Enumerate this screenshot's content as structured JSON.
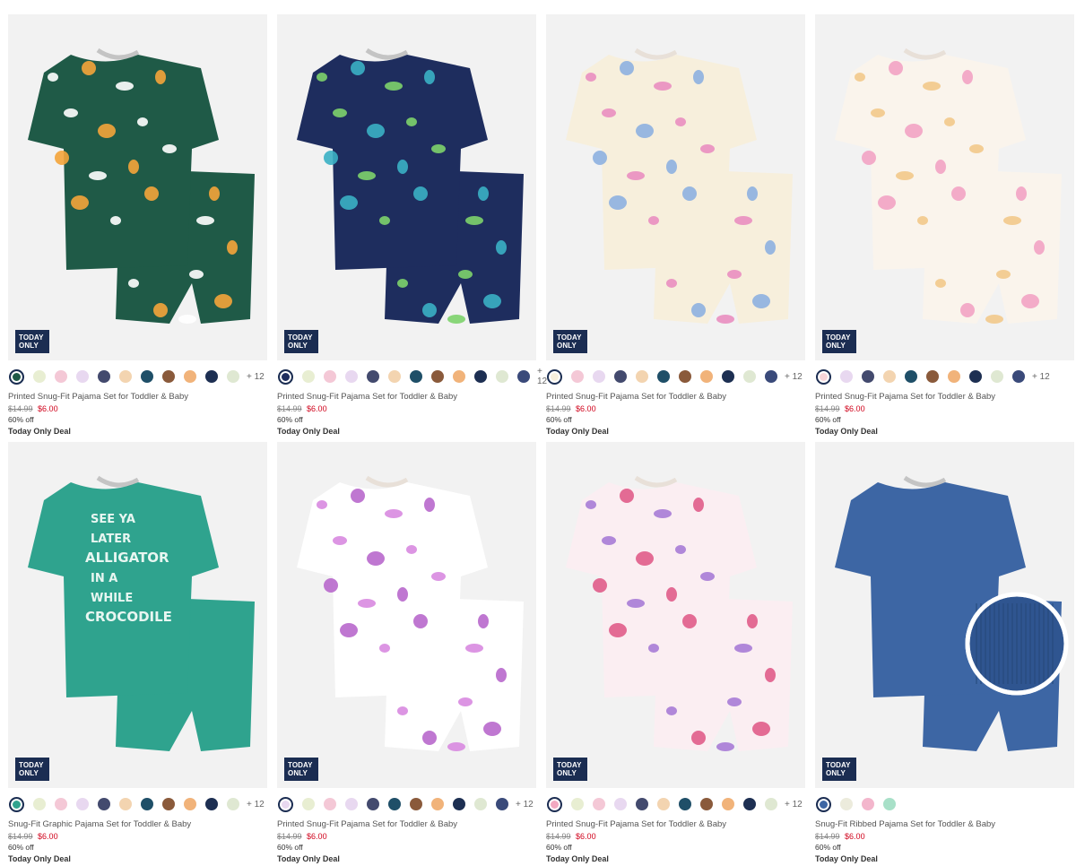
{
  "products": [
    {
      "title": "Printed Snug-Fit Pajama Set for Toddler & Baby",
      "badge": [
        "TODAY",
        "ONLY"
      ],
      "price_was": "$14.99",
      "price_now": "$6.00",
      "discount": "60% off",
      "deal": "Today Only Deal",
      "more_colors": "+ 12",
      "art": {
        "bg": "#1f5a47",
        "accent": "#f4a43a",
        "accent2": "#ffffff"
      },
      "swatches": [
        "#1f5a47",
        "#e8eed2",
        "#f4c8d6",
        "#e8d8f0",
        "#434a6e",
        "#f3d4b0",
        "#1f4f68",
        "#8a5a3b",
        "#f1b37a",
        "#1d2f52",
        "#dfe8d2"
      ]
    },
    {
      "title": "Printed Snug-Fit Pajama Set for Toddler & Baby",
      "badge": [
        "TODAY",
        "ONLY"
      ],
      "price_was": "$14.99",
      "price_now": "$6.00",
      "discount": "60% off",
      "deal": "Today Only Deal",
      "more_colors": "+ 12",
      "art": {
        "bg": "#1e2d5e",
        "accent": "#3ab0c4",
        "accent2": "#7dd36b"
      },
      "swatches": [
        "#1e2d5e",
        "#e8eed2",
        "#f4c8d6",
        "#e8d8f0",
        "#434a6e",
        "#f3d4b0",
        "#1f4f68",
        "#8a5a3b",
        "#f1b37a",
        "#1d2f52",
        "#dfe8d2",
        "#3a4a7a"
      ]
    },
    {
      "title": "Printed Snug-Fit Pajama Set for Toddler & Baby",
      "badge": [
        "TODAY",
        "ONLY"
      ],
      "price_was": "$14.99",
      "price_now": "$6.00",
      "discount": "60% off",
      "deal": "Today Only Deal",
      "more_colors": "+ 12",
      "art": {
        "bg": "#f7efdc",
        "accent": "#8db0e0",
        "accent2": "#e98ec0"
      },
      "swatches": [
        "#f7efdc",
        "#f4c8d6",
        "#e8d8f0",
        "#434a6e",
        "#f3d4b0",
        "#1f4f68",
        "#8a5a3b",
        "#f1b37a",
        "#1d2f52",
        "#dfe8d2",
        "#3a4a7a"
      ]
    },
    {
      "title": "Printed Snug-Fit Pajama Set for Toddler & Baby",
      "badge": [
        "TODAY",
        "ONLY"
      ],
      "price_was": "$14.99",
      "price_now": "$6.00",
      "discount": "60% off",
      "deal": "Today Only Deal",
      "more_colors": "+ 12",
      "art": {
        "bg": "#faf4ec",
        "accent": "#f2a3c4",
        "accent2": "#f2c98b"
      },
      "swatches": [
        "#f8d4d8",
        "#e8d8f0",
        "#434a6e",
        "#f3d4b0",
        "#1f4f68",
        "#8a5a3b",
        "#f1b37a",
        "#1d2f52",
        "#dfe8d2",
        "#3a4a7a"
      ]
    },
    {
      "title": "Snug-Fit Graphic Pajama Set for Toddler & Baby",
      "badge": [
        "TODAY",
        "ONLY"
      ],
      "price_was": "$14.99",
      "price_now": "$6.00",
      "discount": "60% off",
      "deal": "Today Only Deal",
      "more_colors": "+ 12",
      "graphic_text": [
        "SEE YA",
        "LATER",
        "ALLIGATOR",
        "IN A",
        "WHILE",
        "CROCODILE"
      ],
      "art": {
        "bg": "#2fa38e",
        "accent": "#1d6b5c",
        "accent2": "#ffffff"
      },
      "swatches": [
        "#2fa38e",
        "#e8eed2",
        "#f4c8d6",
        "#e8d8f0",
        "#434a6e",
        "#f3d4b0",
        "#1f4f68",
        "#8a5a3b",
        "#f1b37a",
        "#1d2f52",
        "#dfe8d2"
      ]
    },
    {
      "title": "Printed Snug-Fit Pajama Set for Toddler & Baby",
      "badge": [
        "TODAY",
        "ONLY"
      ],
      "price_was": "$14.99",
      "price_now": "$6.00",
      "discount": "60% off",
      "deal": "Today Only Deal",
      "more_colors": "+ 12",
      "art": {
        "bg": "#ffffff",
        "accent": "#b868cc",
        "accent2": "#d88ae0"
      },
      "swatches": [
        "#e8d8f0",
        "#e8eed2",
        "#f4c8d6",
        "#e8d8f0",
        "#434a6e",
        "#1f4f68",
        "#8a5a3b",
        "#f1b37a",
        "#1d2f52",
        "#dfe8d2",
        "#3a4a7a"
      ]
    },
    {
      "title": "Printed Snug-Fit Pajama Set for Toddler & Baby",
      "badge": [
        "TODAY",
        "ONLY"
      ],
      "price_was": "$14.99",
      "price_now": "$6.00",
      "discount": "60% off",
      "deal": "Today Only Deal",
      "more_colors": "+ 12",
      "art": {
        "bg": "#fbeef2",
        "accent": "#e05c8a",
        "accent2": "#a77bd6"
      },
      "swatches": [
        "#f2a8c0",
        "#e8eed2",
        "#f4c8d6",
        "#e8d8f0",
        "#434a6e",
        "#f3d4b0",
        "#1f4f68",
        "#8a5a3b",
        "#f1b37a",
        "#1d2f52",
        "#dfe8d2"
      ]
    },
    {
      "title": "Snug-Fit Ribbed Pajama Set for Toddler & Baby",
      "badge": [
        "TODAY",
        "ONLY"
      ],
      "price_was": "$14.99",
      "price_now": "$6.00",
      "discount": "60% off",
      "deal": "Today Only Deal",
      "more_colors": "",
      "art": {
        "bg": "#3d66a4",
        "accent": "#2f5590",
        "accent2": "#ffffff"
      },
      "swatches": [
        "#3d66a4",
        "#ecebdc",
        "#f3b6cc",
        "#a8e0c8"
      ]
    }
  ],
  "colors": {
    "badge_bg": "#1b2d52",
    "sale_red": "#d0021b",
    "image_bg": "#f2f2f2"
  }
}
